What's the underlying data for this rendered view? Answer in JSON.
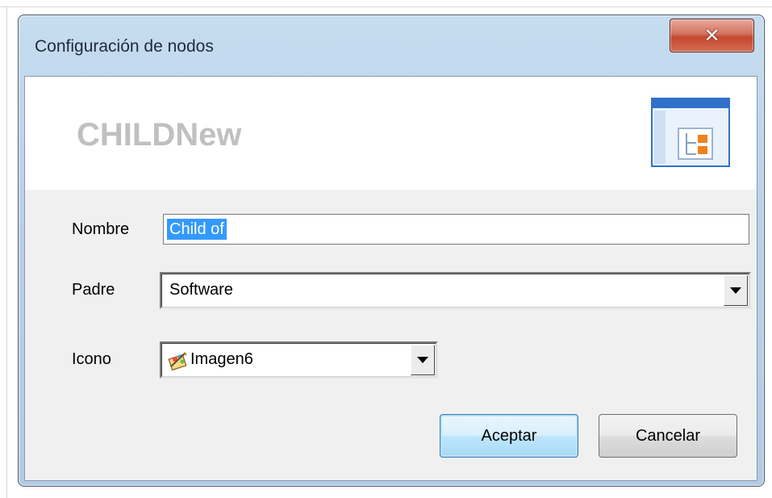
{
  "window": {
    "title": "Configuración de nodos",
    "close_glyph": "✕"
  },
  "header": {
    "title": "CHILDNew",
    "icon": "tree-node-icon"
  },
  "form": {
    "nombre": {
      "label": "Nombre",
      "value": "Child of"
    },
    "padre": {
      "label": "Padre",
      "value": "Software"
    },
    "icono": {
      "label": "Icono",
      "value": "Imagen6",
      "image_icon": "picture-icon"
    }
  },
  "buttons": {
    "accept_label": "Aceptar",
    "cancel_label": "Cancelar"
  },
  "colors": {
    "selection": "#3399ff",
    "close_button": "#c4482d",
    "icon_accent": "#f08020",
    "icon_blue": "#2f72c8"
  }
}
